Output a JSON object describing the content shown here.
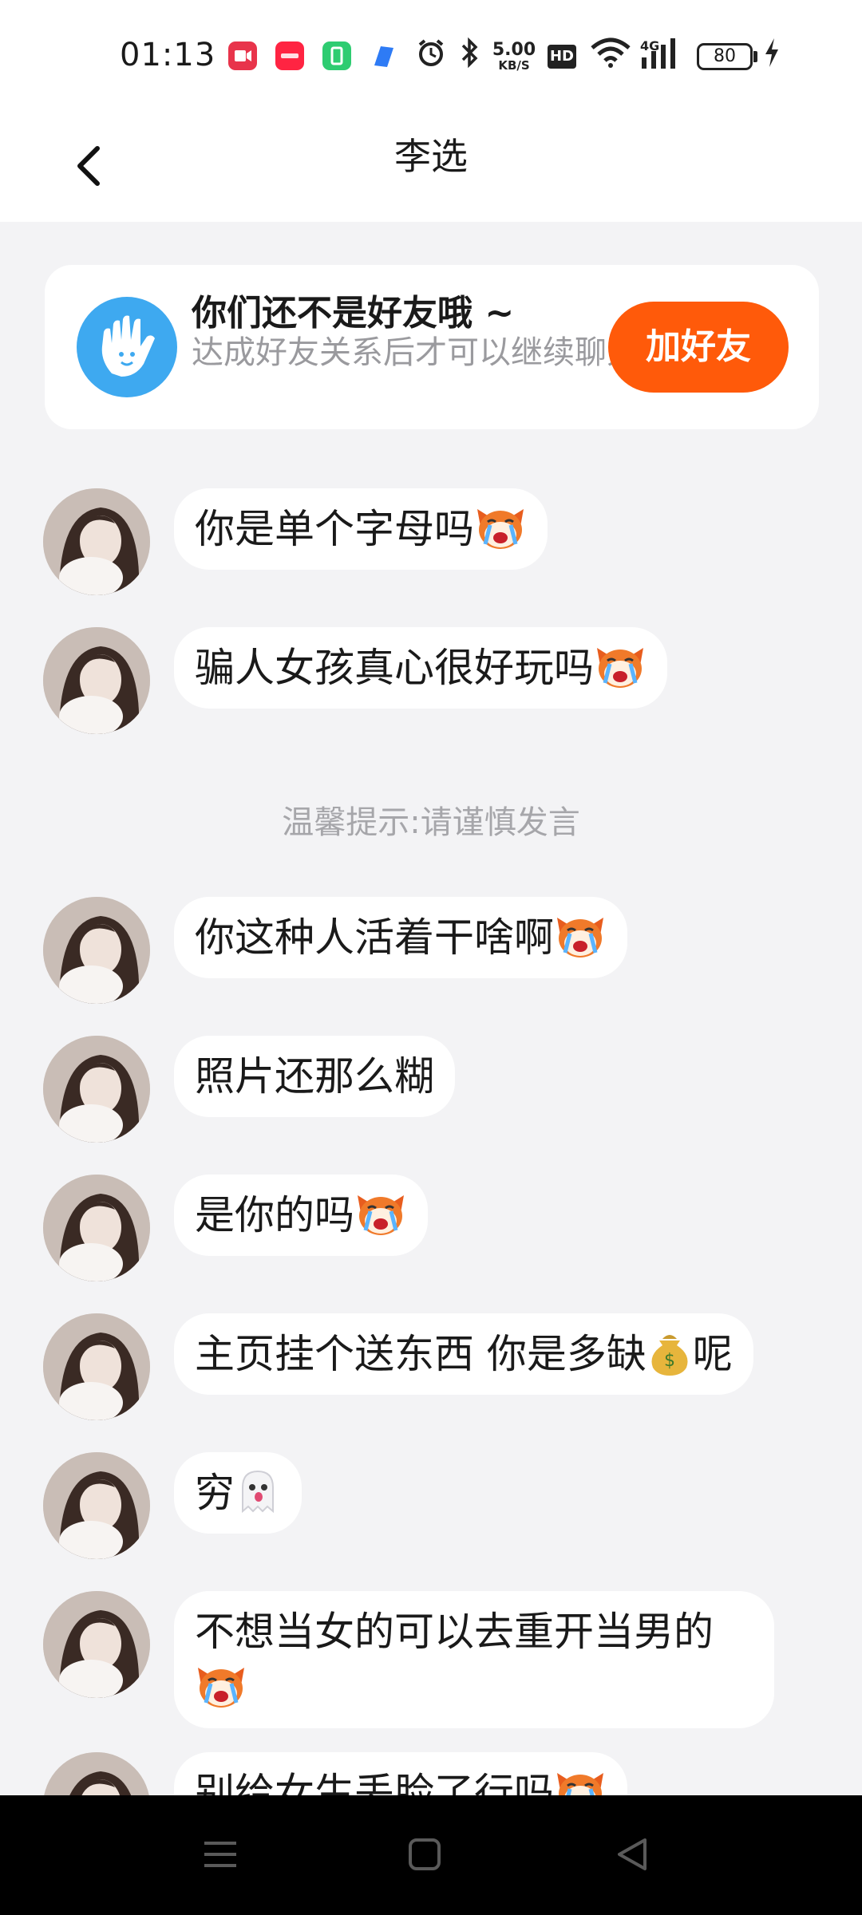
{
  "status_bar": {
    "time": "01:13",
    "net_speed_value": "5.00",
    "net_speed_unit": "KB/S",
    "hd_label": "HD",
    "network_type": "4G",
    "battery_level": "80",
    "app_icons": [
      "video-app-icon",
      "xiaohongshu-icon",
      "wechat-style-icon",
      "browser-icon"
    ],
    "colors": {
      "video": "#e8344b",
      "xiaohongshu": "#ff2442",
      "green_app": "#2ecc71",
      "blue_app": "#2e7bf5"
    }
  },
  "header": {
    "title": "李选",
    "back_icon": "chevron-left-icon"
  },
  "notice": {
    "title": "你们还不是好友哦 ~",
    "subtitle": "达成好友关系后才可以继续聊天",
    "button_label": "加好友",
    "icon": "waving-hand-icon",
    "colors": {
      "icon_bg": "#3ea9f0",
      "button_bg": "#ff5a0a"
    }
  },
  "messages": [
    {
      "text": "你是单个字母吗",
      "emoji": "crying-face-emoji"
    },
    {
      "text": "骗人女孩真心很好玩吗",
      "emoji": "crying-face-emoji"
    },
    {
      "text": "你这种人活着干啥啊",
      "emoji": "crying-face-emoji"
    },
    {
      "text": "照片还那么糊",
      "emoji": ""
    },
    {
      "text": "是你的吗",
      "emoji": "crying-face-emoji"
    },
    {
      "text": "主页挂个送东西 你是多缺",
      "emoji": "money-bag-emoji",
      "text_after": "呢"
    },
    {
      "text": "穷",
      "emoji": "ghost-emoji"
    },
    {
      "text": "不想当女的可以去重开当男的",
      "emoji": "crying-face-emoji"
    },
    {
      "text": "别给女生丢脸了行吗",
      "emoji": "crying-face-emoji"
    }
  ],
  "hint": "温馨提示:请谨慎发言",
  "nav_bar": {
    "buttons": [
      "menu-icon",
      "home-icon",
      "back-triangle-icon"
    ]
  }
}
